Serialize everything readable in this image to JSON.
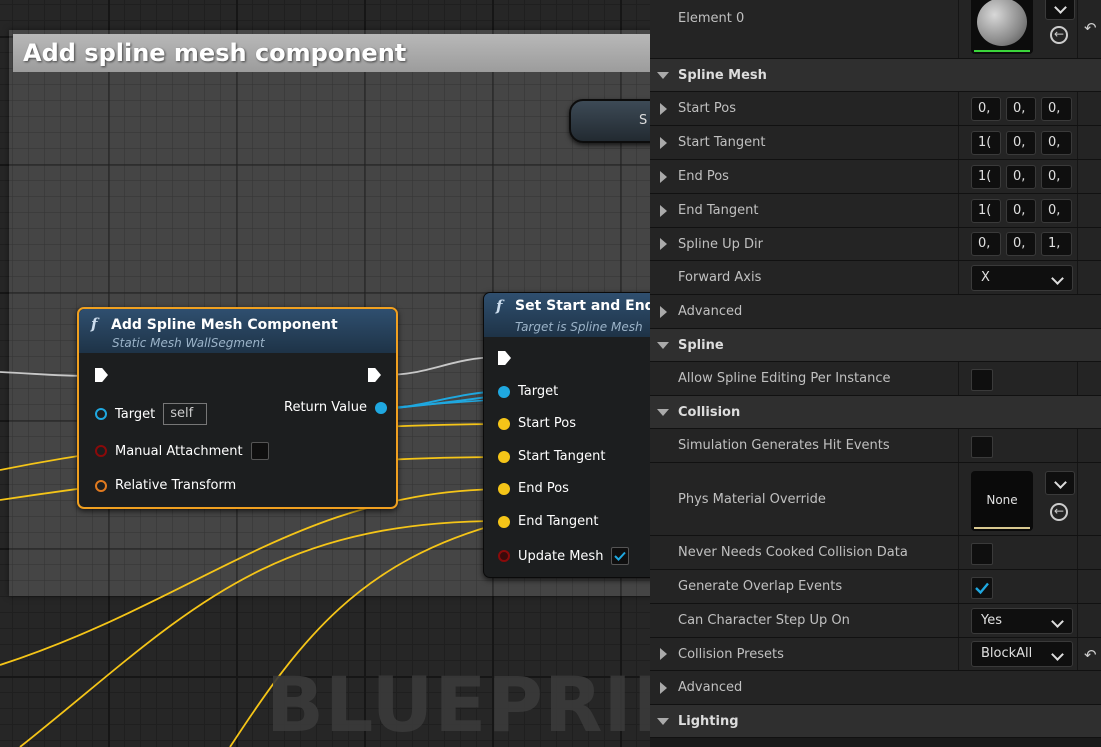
{
  "graph": {
    "comment_title": "Add spline mesh component",
    "watermark": "BLUEPRINT",
    "fn_glyph": "f",
    "node_add": {
      "title": "Add Spline Mesh Component",
      "subtitle": "Static Mesh WallSegment",
      "pins": {
        "target_label": "Target",
        "target_value": "self",
        "manual_attachment_label": "Manual Attachment",
        "manual_attachment_checked": false,
        "relative_transform_label": "Relative Transform",
        "return_value_label": "Return Value"
      }
    },
    "node_set": {
      "title": "Set Start and End",
      "subtitle": "Target is Spline Mesh",
      "pins": {
        "target": "Target",
        "start_pos": "Start Pos",
        "start_tangent": "Start Tangent",
        "end_pos": "End Pos",
        "end_tangent": "End Tangent",
        "update_mesh": "Update Mesh",
        "update_mesh_checked": true
      }
    },
    "partial_node_text": "S",
    "colors": {
      "object_pin": "#1fa8e0",
      "vector_pin": "#f5c518",
      "struct_pin": "#e07a1f",
      "bool_pin": "#8a0a0a",
      "node_highlight": "#f0a020",
      "wire_exec": "#c8c8c8"
    }
  },
  "details": {
    "element0": {
      "label": "Element 0"
    },
    "spline_mesh": {
      "category": "Spline Mesh",
      "start_pos": {
        "label": "Start Pos",
        "values": [
          "0,",
          "0,",
          "0,"
        ]
      },
      "start_tangent": {
        "label": "Start Tangent",
        "values": [
          "1(",
          "0,",
          "0,"
        ]
      },
      "end_pos": {
        "label": "End Pos",
        "values": [
          "1(",
          "0,",
          "0,"
        ]
      },
      "end_tangent": {
        "label": "End Tangent",
        "values": [
          "1(",
          "0,",
          "0,"
        ]
      },
      "spline_up_dir": {
        "label": "Spline Up Dir",
        "values": [
          "0,",
          "0,",
          "1,"
        ]
      },
      "forward_axis": {
        "label": "Forward Axis",
        "value": "X"
      },
      "advanced": "Advanced"
    },
    "spline": {
      "category": "Spline",
      "allow_editing": {
        "label": "Allow Spline Editing Per Instance",
        "checked": false
      }
    },
    "collision": {
      "category": "Collision",
      "sim_hit_events": {
        "label": "Simulation Generates Hit Events",
        "checked": false
      },
      "phys_material": {
        "label": "Phys Material Override",
        "value": "None"
      },
      "never_cooked": {
        "label": "Never Needs Cooked Collision Data",
        "checked": false
      },
      "overlap_events": {
        "label": "Generate Overlap Events",
        "checked": true
      },
      "step_up": {
        "label": "Can Character Step Up On",
        "value": "Yes"
      },
      "presets": {
        "label": "Collision Presets",
        "value": "BlockAll"
      },
      "advanced": "Advanced"
    },
    "lighting": {
      "category": "Lighting"
    }
  }
}
